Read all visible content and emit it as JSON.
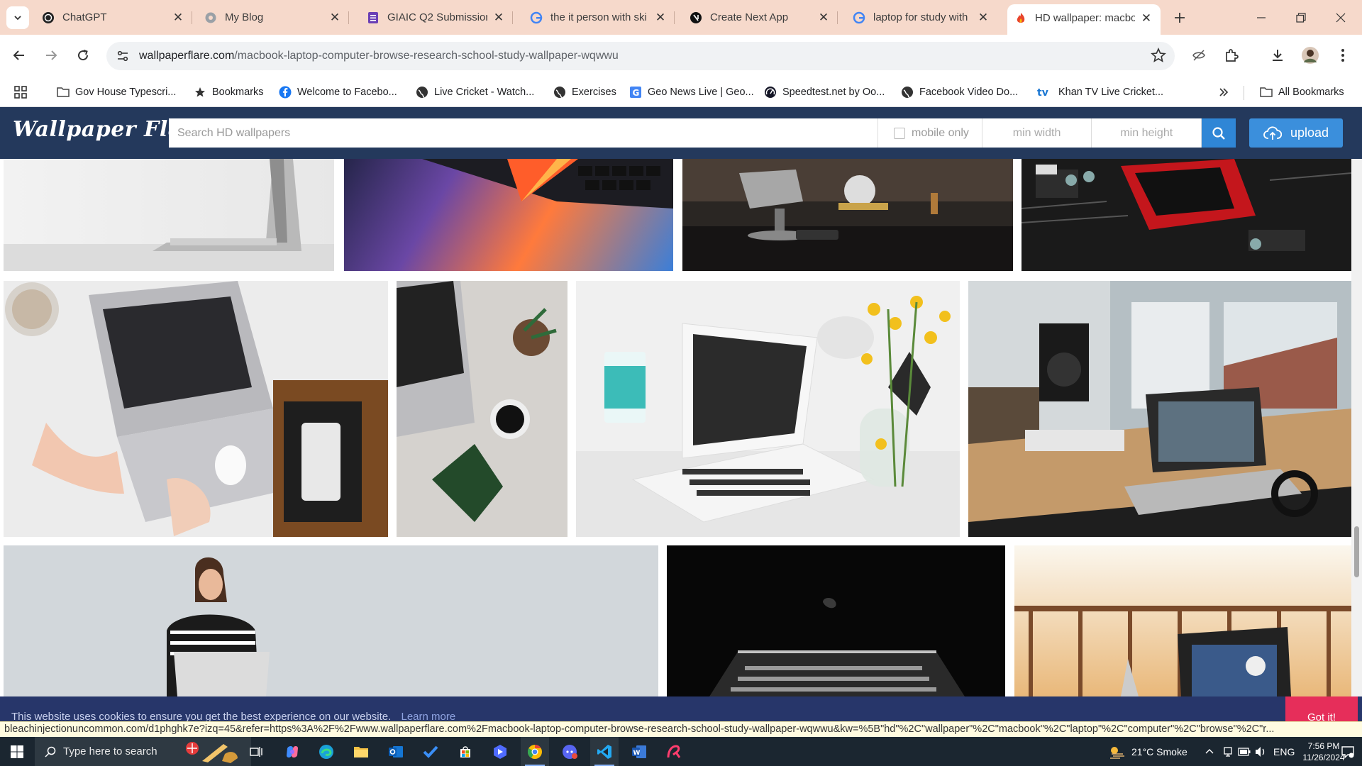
{
  "tabs": [
    {
      "title": "ChatGPT",
      "icon": "chatgpt-icon"
    },
    {
      "title": "My Blog",
      "icon": "globe-icon"
    },
    {
      "title": "GIAIC Q2 Submission",
      "icon": "forms-icon"
    },
    {
      "title": "the it person with ski",
      "icon": "google-icon"
    },
    {
      "title": "Create Next App",
      "icon": "nextjs-icon"
    },
    {
      "title": "laptop for study with",
      "icon": "google-icon"
    },
    {
      "title": "HD wallpaper: macbo",
      "icon": "flame-icon"
    }
  ],
  "address_bar": {
    "domain": "wallpaperflare.com",
    "path": "/macbook-laptop-computer-browse-research-school-study-wallpaper-wqwwu"
  },
  "bookmarks": [
    {
      "label": "Gov House Typescri...",
      "icon": "folder-icon"
    },
    {
      "label": "Bookmarks",
      "icon": "star-icon"
    },
    {
      "label": "Welcome to Facebo...",
      "icon": "facebook-icon"
    },
    {
      "label": "Live Cricket - Watch...",
      "icon": "globe-icon"
    },
    {
      "label": "Exercises",
      "icon": "globe-icon"
    },
    {
      "label": "Geo News Live | Geo...",
      "icon": "geo-icon"
    },
    {
      "label": "Speedtest.net by Oo...",
      "icon": "speedtest-icon"
    },
    {
      "label": "Facebook Video Do...",
      "icon": "globe-icon"
    },
    {
      "label": "Khan TV Live Cricket...",
      "icon": "tv-icon"
    }
  ],
  "all_bookmarks": "All Bookmarks",
  "site": {
    "logo": "Wallpaper Flare",
    "search_placeholder": "Search HD wallpapers",
    "mobile_only": "mobile only",
    "min_width": "min width",
    "min_height": "min height",
    "upload": "upload"
  },
  "cookie": {
    "text": "This website uses cookies to ensure you get the best experience on our website.",
    "learn_more": "Learn more",
    "button": "Got it!"
  },
  "status_url": "bleachinjectionuncommon.com/d1phghk7e?izq=45&refer=https%3A%2F%2Fwww.wallpaperflare.com%2Fmacbook-laptop-computer-browse-research-school-study-wallpaper-wqwwu&kw=%5B\"hd\"%2C\"wallpaper\"%2C\"macbook\"%2C\"laptop\"%2C\"computer\"%2C\"browse\"%2C\"r...",
  "taskbar": {
    "search_placeholder": "Type here to search",
    "weather": "21°C  Smoke",
    "lang": "ENG",
    "time": "7:56 PM",
    "date": "11/26/2024"
  },
  "colors": {
    "tab_strip": "#f6d9cb",
    "site_header": "#24395c",
    "search_button": "#2f86d6",
    "upload_button": "#3b8fdc",
    "cookie_bar": "#27366a",
    "cookie_button": "#e62e5a",
    "taskbar": "#1b2630"
  }
}
